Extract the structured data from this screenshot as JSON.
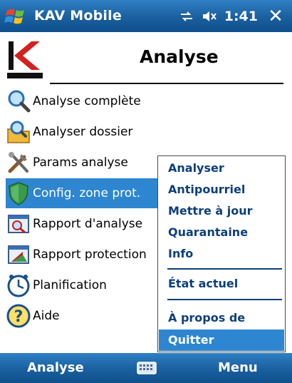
{
  "titlebar": {
    "app_title": "KAV Mobile",
    "time": "1:41",
    "close_glyph": "✕"
  },
  "header": {
    "title": "Analyse"
  },
  "list": {
    "items": [
      {
        "label": "Analyse complète",
        "icon": "magnifier-icon"
      },
      {
        "label": "Analyser dossier",
        "icon": "folder-search-icon"
      },
      {
        "label": "Params analyse",
        "icon": "tools-icon"
      },
      {
        "label": "Config. zone prot.",
        "icon": "shield-icon",
        "selected": true
      },
      {
        "label": "Rapport d'analyse",
        "icon": "report-scan-icon"
      },
      {
        "label": "Rapport protection",
        "icon": "report-protection-icon"
      },
      {
        "label": "Planification",
        "icon": "clock-icon"
      },
      {
        "label": "Aide",
        "icon": "help-icon"
      }
    ]
  },
  "menu": {
    "items": [
      {
        "label": "Analyser"
      },
      {
        "label": "Antipourriel"
      },
      {
        "label": "Mettre à jour"
      },
      {
        "label": "Quarantaine"
      },
      {
        "label": "Info"
      },
      {
        "label": "État actuel"
      },
      {
        "label": "À propos de"
      },
      {
        "label": "Quitter",
        "highlight": true
      }
    ]
  },
  "bottombar": {
    "left_softkey": "Analyse",
    "right_softkey": "Menu"
  },
  "colors": {
    "bar_blue": "#1a5f9e",
    "selection_blue": "#2d86cf",
    "menu_text": "#0d3f7a"
  }
}
